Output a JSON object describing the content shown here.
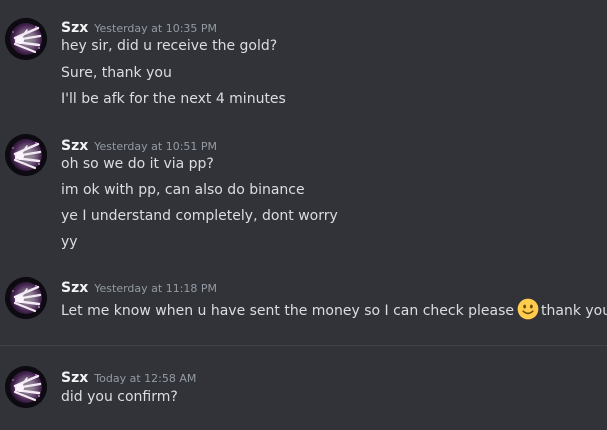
{
  "groups": [
    {
      "username": "Szx",
      "timestamp": "Yesterday at 10:35 PM",
      "messages": [
        "hey sir, did u receive the gold?",
        "Sure, thank you",
        "I'll be afk for the next 4 minutes"
      ]
    },
    {
      "username": "Szx",
      "timestamp": "Yesterday at 10:51 PM",
      "messages": [
        "oh so we do it via pp?",
        "im ok with pp, can also do binance",
        "ye I understand completely, dont worry",
        "yy"
      ]
    },
    {
      "username": "Szx",
      "timestamp": "Yesterday at 11:18 PM",
      "messages": [
        {
          "before_emoji": "Let me know when u have sent the money so I can check please",
          "emoji": "slightly-smiling-face",
          "after_emoji": "thank you"
        }
      ]
    },
    {
      "username": "Szx",
      "timestamp": "Today at 12:58 AM",
      "messages": [
        "did you confirm?"
      ]
    }
  ],
  "colors": {
    "background": "#313338",
    "username": "#f2f3f5",
    "timestamp": "#949ba4",
    "message_text": "#dbdee1",
    "divider": "#3f4147",
    "emoji_face": "#ffcc4d"
  }
}
